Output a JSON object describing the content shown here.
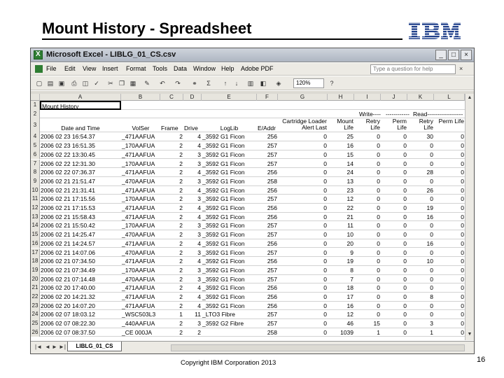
{
  "slide": {
    "title": "Mount History - Spreadsheet",
    "footer": "Copyright IBM Corporation 2013",
    "page_number": "16",
    "logo": "IBM"
  },
  "window": {
    "title": "Microsoft Excel - LIBLG_01_CS.csv",
    "controls": [
      "_",
      "□",
      "×"
    ]
  },
  "menubar": {
    "items": [
      "File",
      "Edit",
      "View",
      "Insert",
      "Format",
      "Tools",
      "Data",
      "Window",
      "Help",
      "Adobe PDF"
    ],
    "help_placeholder": "Type a question for help"
  },
  "toolbar": {
    "zoom": "120%"
  },
  "columns": [
    "A",
    "B",
    "C",
    "D",
    "E",
    "F",
    "G",
    "H",
    "I",
    "J",
    "K",
    "L"
  ],
  "row_numbers": [
    "1",
    "2",
    "3",
    "4",
    "5",
    "6",
    "7",
    "8",
    "9",
    "10",
    "11",
    "12",
    "13",
    "14",
    "15",
    "16",
    "17",
    "18",
    "19",
    "20",
    "21",
    "22",
    "23",
    "24",
    "25",
    "26"
  ],
  "sheet": {
    "a1": "Mount History",
    "row2": {
      "write": "Write----",
      "dashes": "------------",
      "read": "Read------------------"
    },
    "headers": [
      "Date and Time",
      "VolSer",
      "Frame",
      "Drive",
      "LogLib",
      "E/Addr",
      "Cartridge Loader Alert Last",
      "Mount Life",
      "Retry Life",
      "Perm Life",
      "Retry Life",
      "Perm Life"
    ],
    "rows": [
      [
        "2006 02 23 16:54.37",
        "_471AAFUA",
        "2",
        "4",
        "_3592 G1 Ficon",
        "256",
        "0",
        "25",
        "0",
        "0",
        "30",
        "0"
      ],
      [
        "2006 02 23 16:51.35",
        "_170AAFUA",
        "2",
        "4",
        "_3592 G1 Ficon",
        "257",
        "0",
        "16",
        "0",
        "0",
        "0",
        "0"
      ],
      [
        "2006 02 22 13:30.45",
        "_471AAFUA",
        "2",
        "3",
        "_3592 G1 Ficon",
        "257",
        "0",
        "15",
        "0",
        "0",
        "0",
        "0"
      ],
      [
        "2006 02 22 12:31.30",
        "_170AAFUA",
        "2",
        "3",
        "_3592 G1 Ficon",
        "257",
        "0",
        "14",
        "0",
        "0",
        "0",
        "0"
      ],
      [
        "2006 02 22 07:36.37",
        "_471AAFUA",
        "2",
        "4",
        "_3592 G1 Ficon",
        "256",
        "0",
        "24",
        "0",
        "0",
        "28",
        "0"
      ],
      [
        "2006 02 21 21:51.47",
        "_470AAFUA",
        "2",
        "3",
        "_3592 G1 Ficon",
        "258",
        "0",
        "13",
        "0",
        "0",
        "0",
        "0"
      ],
      [
        "2006 02 21 21:31.41",
        "_471AAFUA",
        "2",
        "4",
        "_3592 G1 Ficon",
        "256",
        "0",
        "23",
        "0",
        "0",
        "26",
        "0"
      ],
      [
        "2006 02 21 17:15.56",
        "_170AAFUA",
        "2",
        "3",
        "_3592 G1 Ficon",
        "257",
        "0",
        "12",
        "0",
        "0",
        "0",
        "0"
      ],
      [
        "2006 02 21 17:15.53",
        "_471AAFUA",
        "2",
        "4",
        "_3592 G1 Ficon",
        "256",
        "0",
        "22",
        "0",
        "0",
        "19",
        "0"
      ],
      [
        "2006 02 21 15:58.43",
        "_471AAFUA",
        "2",
        "4",
        "_3592 G1 Ficon",
        "256",
        "0",
        "21",
        "0",
        "0",
        "16",
        "0"
      ],
      [
        "2006 02 21 15:50.42",
        "_170AAFUA",
        "2",
        "3",
        "_3592 G1 Ficon",
        "257",
        "0",
        "11",
        "0",
        "0",
        "0",
        "0"
      ],
      [
        "2006 02 21 14:25.47",
        "_470AAFUA",
        "2",
        "3",
        "_3592 G1 Ficon",
        "257",
        "0",
        "10",
        "0",
        "0",
        "0",
        "0"
      ],
      [
        "2006 02 21 14:24.57",
        "_471AAFUA",
        "2",
        "4",
        "_3592 G1 Ficon",
        "256",
        "0",
        "20",
        "0",
        "0",
        "16",
        "0"
      ],
      [
        "2006 02 21 14:07.06",
        "_470AAFUA",
        "2",
        "3",
        "_3592 G1 Ficon",
        "257",
        "0",
        "9",
        "0",
        "0",
        "0",
        "0"
      ],
      [
        "2006 02 21 07:34.50",
        "_471AAFUA",
        "2",
        "4",
        "_3592 G1 Ficon",
        "256",
        "0",
        "19",
        "0",
        "0",
        "10",
        "0"
      ],
      [
        "2006 02 21 07:34.49",
        "_170AAFUA",
        "2",
        "3",
        "_3592 G1 Ficon",
        "257",
        "0",
        "8",
        "0",
        "0",
        "0",
        "0"
      ],
      [
        "2006 02 21 07:14.48",
        "_470AAFUA",
        "2",
        "3",
        "_3592 G1 Ficon",
        "257",
        "0",
        "7",
        "0",
        "0",
        "0",
        "0"
      ],
      [
        "2006 02 20 17:40.00",
        "_471AAFUA",
        "2",
        "4",
        "_3592 G1 Ficon",
        "256",
        "0",
        "18",
        "0",
        "0",
        "0",
        "0"
      ],
      [
        "2006 02 20 14:21.32",
        "_471AAFUA",
        "2",
        "4",
        "_3592 G1 Ficon",
        "256",
        "0",
        "17",
        "0",
        "0",
        "8",
        "0"
      ],
      [
        "2006 02 20 14:07.20",
        "_471AAFUA",
        "2",
        "4",
        "_3592 G1 Ficon",
        "256",
        "0",
        "16",
        "0",
        "0",
        "0",
        "0"
      ],
      [
        "2006 02 07 18:03.12",
        "_WSC503L3",
        "1",
        "11",
        "_LTO3 Fibre",
        "257",
        "0",
        "12",
        "0",
        "0",
        "0",
        "0"
      ],
      [
        "2006 02 07 08:22.30",
        "_440AAFUA",
        "2",
        "3",
        "_3592 G2 Fibre",
        "257",
        "0",
        "46",
        "15",
        "0",
        "3",
        "0"
      ],
      [
        "2006 02 07 08:37.50",
        "_CE 000JA",
        "2",
        "2",
        "",
        "258",
        "0",
        "1039",
        "1",
        "0",
        "1",
        "0"
      ]
    ]
  },
  "sheet_tab": "LIBLG_01_CS"
}
